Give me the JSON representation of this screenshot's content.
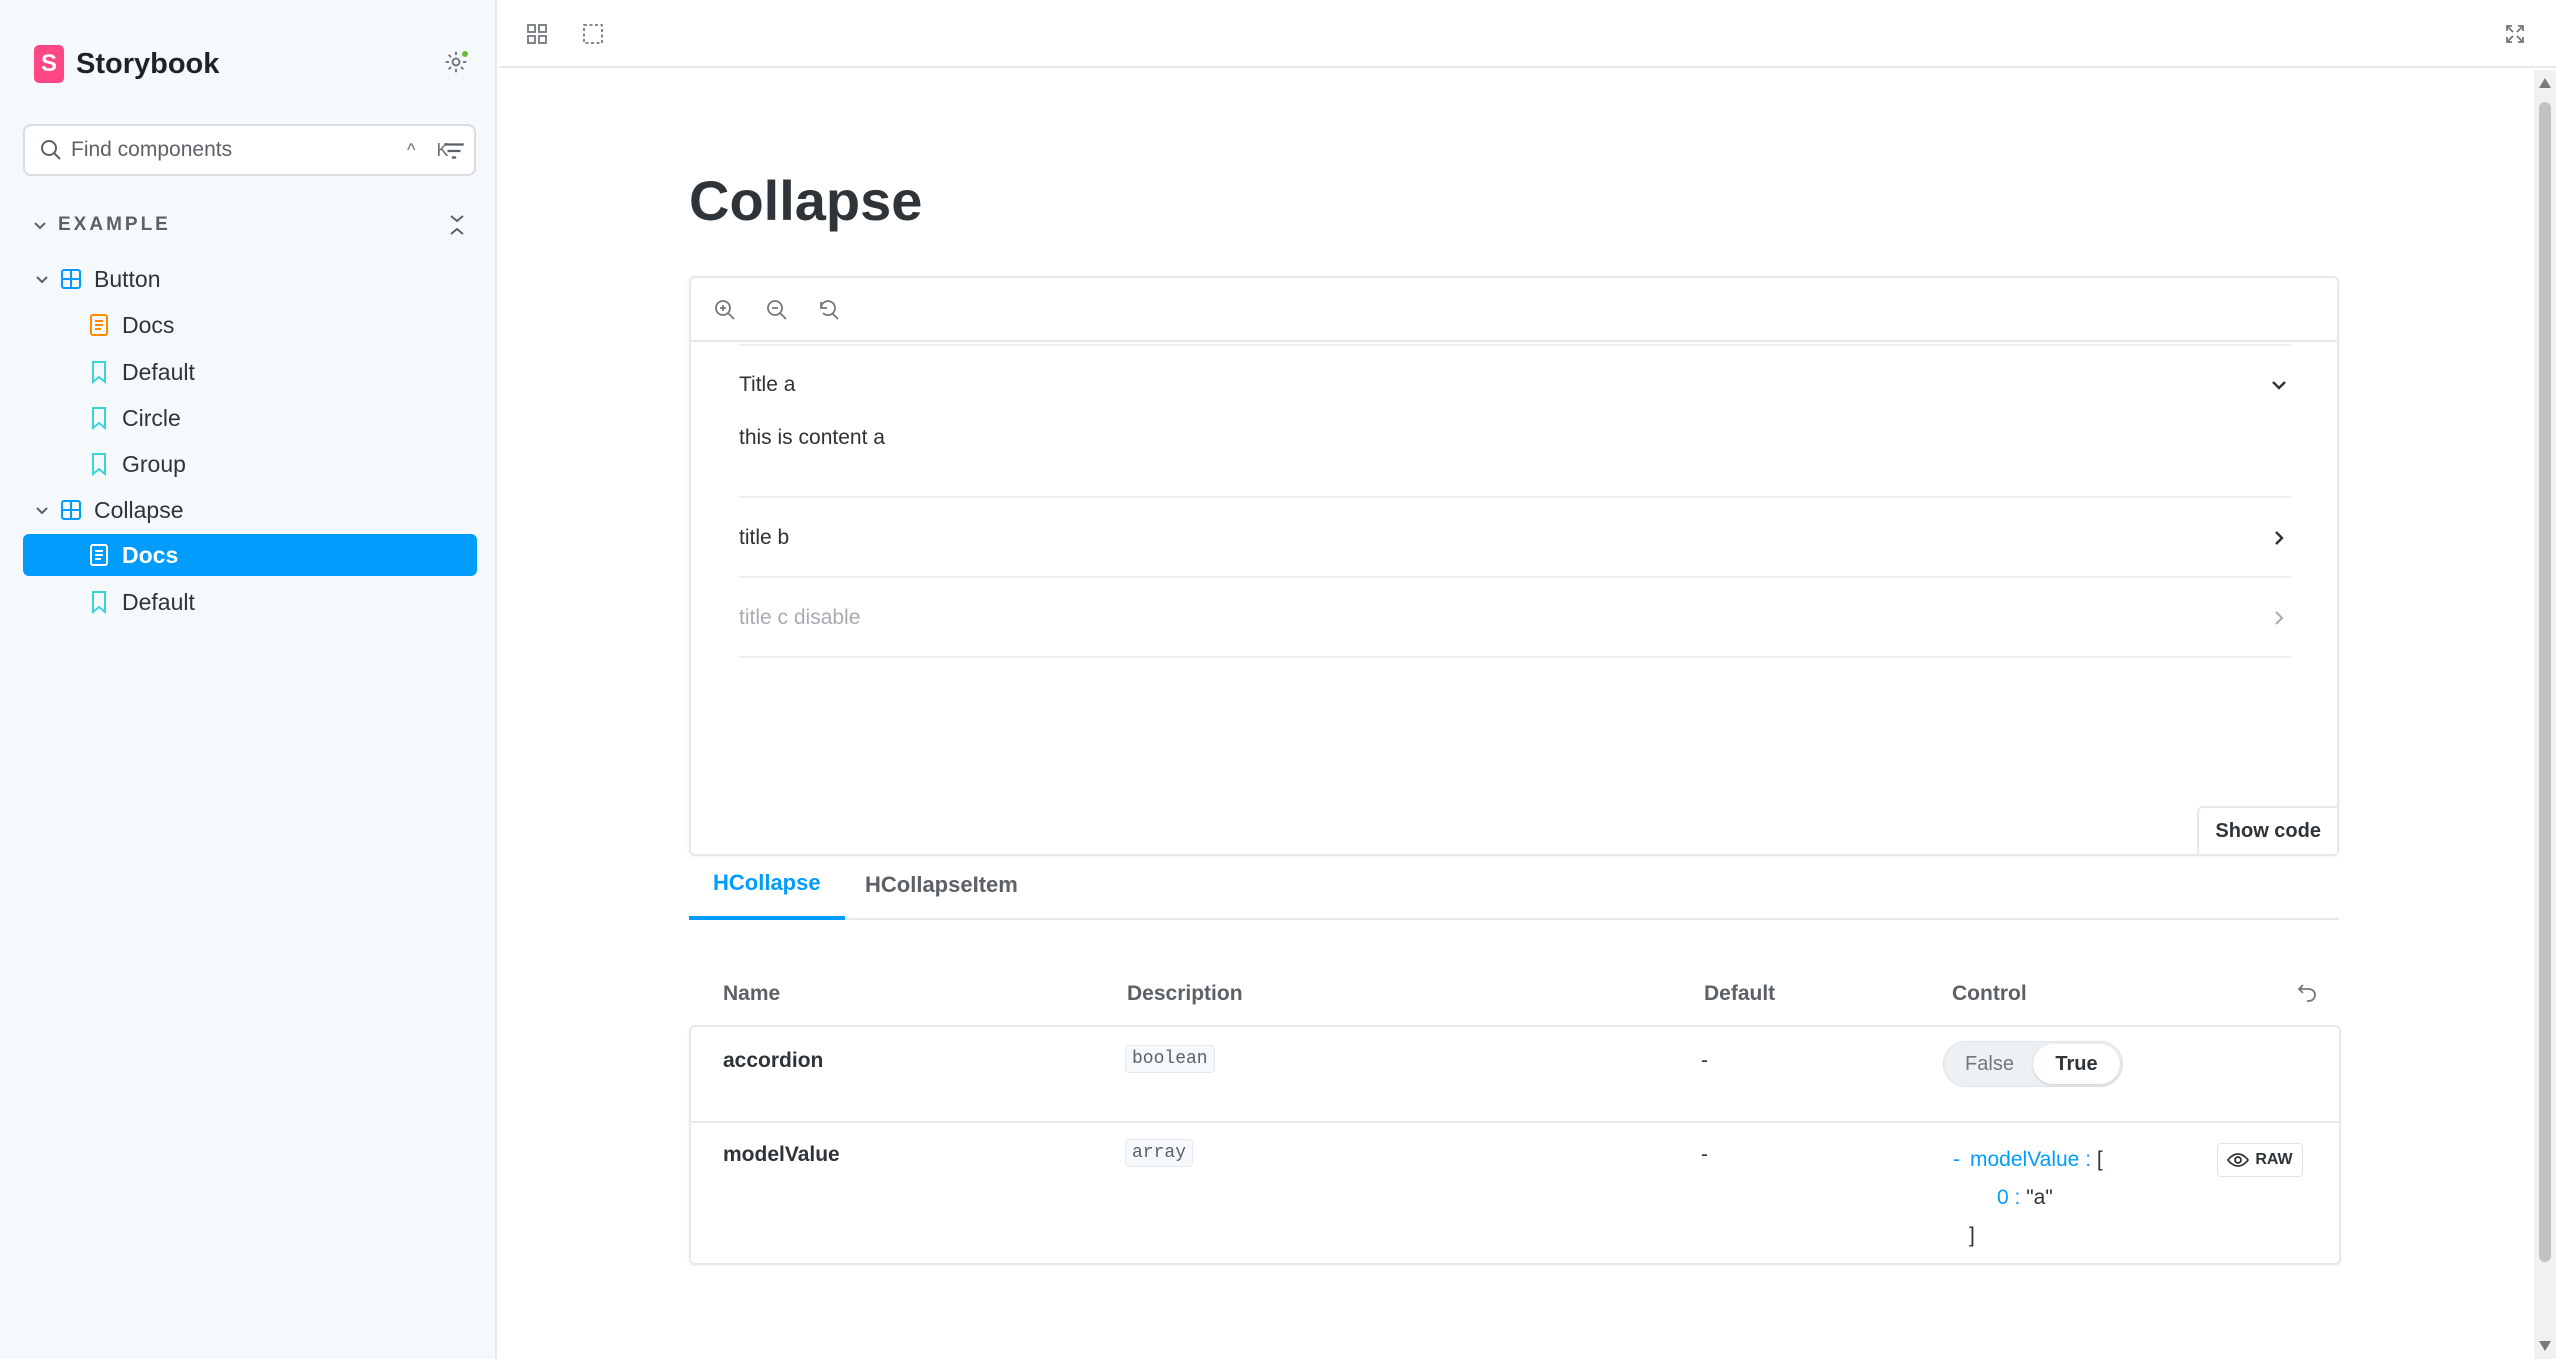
{
  "brand": {
    "name": "Storybook",
    "logo_letter": "S",
    "color": "#ff4785"
  },
  "search": {
    "placeholder": "Find components",
    "shortcut": "^ K"
  },
  "sidebar": {
    "group_label": "EXAMPLE",
    "items": [
      {
        "label": "Button",
        "type": "component"
      },
      {
        "label": "Docs",
        "type": "docs"
      },
      {
        "label": "Default",
        "type": "story"
      },
      {
        "label": "Circle",
        "type": "story"
      },
      {
        "label": "Group",
        "type": "story"
      },
      {
        "label": "Collapse",
        "type": "component"
      },
      {
        "label": "Docs",
        "type": "docs",
        "selected": true
      },
      {
        "label": "Default",
        "type": "story"
      }
    ],
    "accent_color": "#029cfd"
  },
  "page": {
    "title": "Collapse"
  },
  "preview": {
    "items": [
      {
        "title": "Title a",
        "content": "this is content a",
        "expanded": true,
        "disabled": false
      },
      {
        "title": "title b",
        "expanded": false,
        "disabled": false
      },
      {
        "title": "title c disable",
        "expanded": false,
        "disabled": true
      }
    ],
    "show_code_label": "Show code"
  },
  "tabs": [
    {
      "label": "HCollapse",
      "active": true
    },
    {
      "label": "HCollapseItem",
      "active": false
    }
  ],
  "args_table": {
    "headers": {
      "name": "Name",
      "description": "Description",
      "default": "Default",
      "control": "Control"
    },
    "rows": [
      {
        "name": "accordion",
        "type": "boolean",
        "default": "-",
        "control": {
          "off": "False",
          "on": "True",
          "value": true
        }
      },
      {
        "name": "modelValue",
        "type": "array",
        "default": "-",
        "control": {
          "key": "modelValue",
          "open": "[",
          "index": "0",
          "value": "\"a\"",
          "close": "]",
          "raw_label": "RAW"
        }
      }
    ]
  }
}
